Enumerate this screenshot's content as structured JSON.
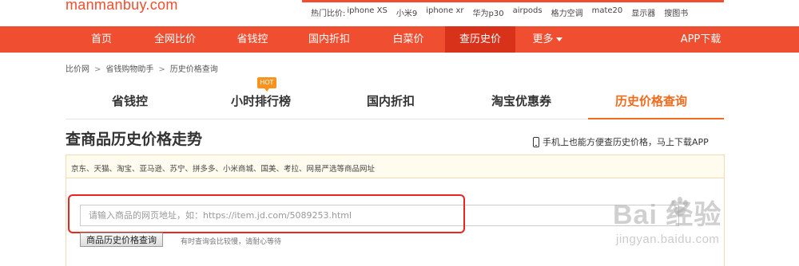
{
  "site": {
    "logo": "manmanbuy.com"
  },
  "hot_search": {
    "label": "热门比价:",
    "keywords": [
      "iphone XS",
      "小米9",
      "iphone xr",
      "华为p30",
      "airpods",
      "格力空调",
      "mate20",
      "显示器",
      "搜图书"
    ]
  },
  "nav": {
    "items": [
      "首页",
      "全网比价",
      "省钱控",
      "国内折扣",
      "白菜价",
      "查历史价",
      "更多",
      "APP下载"
    ],
    "active_index": 5
  },
  "breadcrumb": [
    "比价网",
    "省钱购物助手",
    "历史价格查询"
  ],
  "tabs": {
    "items": [
      "省钱控",
      "小时排行榜",
      "国内折扣",
      "淘宝优惠券",
      "历史价格查询"
    ],
    "active_index": 4,
    "badge": "HOT"
  },
  "main": {
    "title": "查商品历史价格走势",
    "app_tip": "手机上也能方便查历史价格，马上下载APP",
    "supported_sites": "京东、天猫、淘宝、亚马逊、苏宁、拼多多、小米商城、国美、考拉、网易严选等商品网址",
    "url_input": {
      "value": "",
      "placeholder": "请输入商品的网页地址，如：https://item.jd.com/5089253.html"
    },
    "query_button": "商品历史价格查询",
    "wait_hint": "有时查询会比较慢，请耐心等待"
  },
  "watermark": {
    "main": "Bai 经验",
    "sub": "jingyan.baidu.com"
  },
  "colors": {
    "brand": "#f04e30",
    "nav_active": "#d9321a",
    "tab_active": "#f26a1b",
    "highlight": "#e8261e",
    "panel_border": "#f0dcae"
  }
}
